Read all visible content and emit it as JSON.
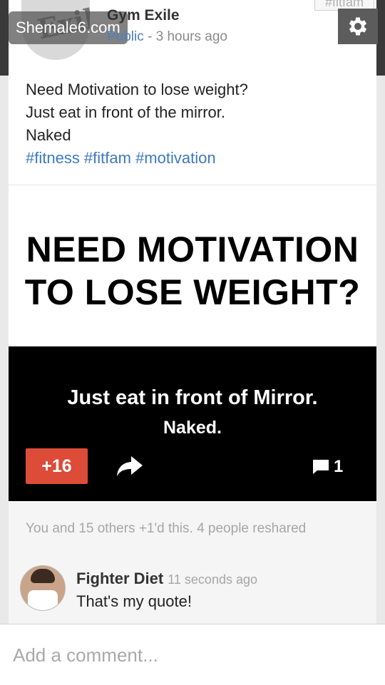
{
  "watermark": "Shemale6.com",
  "post": {
    "author": "Gym Exile",
    "visibility": "Public",
    "time_sep": " - ",
    "time": "3 hours ago",
    "chip_tag": "#fitfam",
    "lines": [
      "Need Motivation to lose weight?",
      "Just eat in front of the mirror.",
      "Naked"
    ],
    "tags": "#fitness #fitfam #motivation"
  },
  "image": {
    "headline_1": "NEED MOTIVATION",
    "headline_2": "TO LOSE WEIGHT?",
    "sub_1": "Just eat in front of Mirror.",
    "sub_2": "Naked."
  },
  "actions": {
    "plus_count": "+16",
    "comment_count": "1"
  },
  "activity": {
    "summary": "You and 15 others +1'd this. 4 people reshared"
  },
  "comment": {
    "author": "Fighter Diet",
    "time": "11 seconds ago",
    "text": "That's my quote!"
  },
  "composer": {
    "placeholder": "Add a comment..."
  },
  "colors": {
    "plus_button": "#dd4b39",
    "link": "#3d78c2"
  },
  "icons": {
    "settings": "gear-icon",
    "share": "share-arrow-icon",
    "comments": "comment-bubble-icon"
  }
}
